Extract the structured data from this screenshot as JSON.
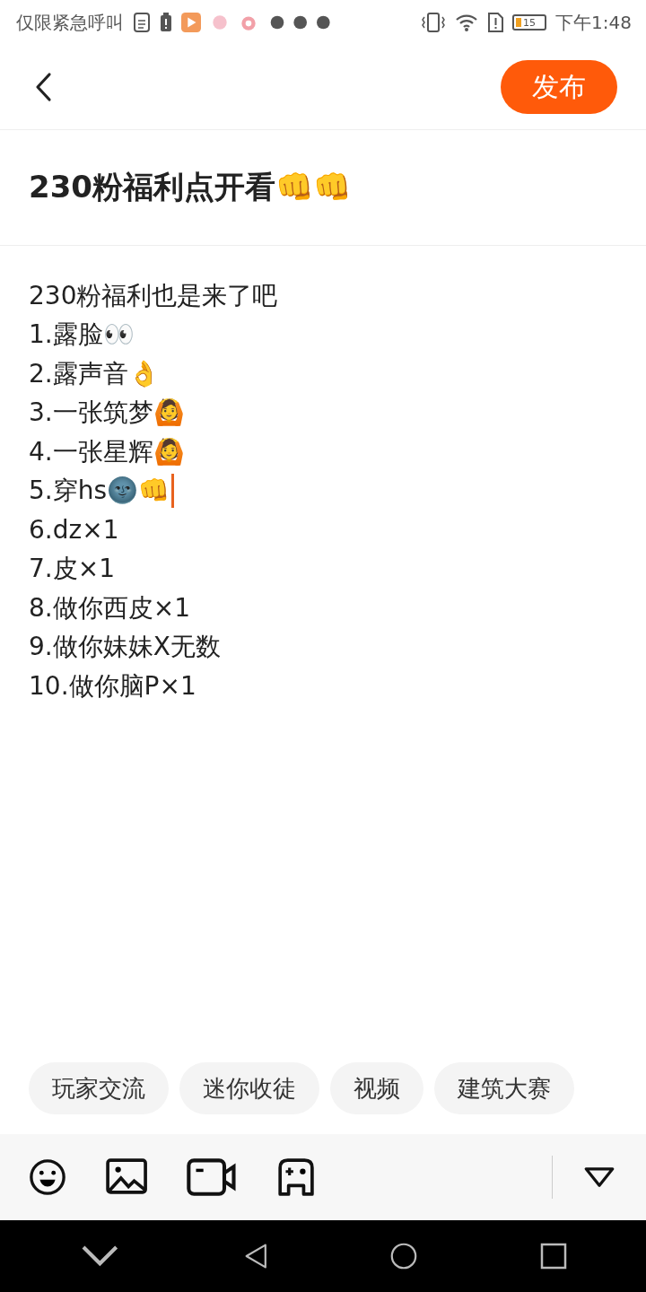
{
  "status_bar": {
    "notice": "仅限紧急呼叫",
    "battery": "15",
    "time": "下午1:48"
  },
  "header": {
    "publish_button": "发布"
  },
  "post": {
    "title": "230粉福利点开看👊👊",
    "lines": [
      {
        "text": "230粉福利也是来了吧",
        "cursor": false
      },
      {
        "text": "1.露脸👀",
        "cursor": false
      },
      {
        "text": "2.露声音👌",
        "cursor": false
      },
      {
        "text": "3.一张筑梦🙆",
        "cursor": false
      },
      {
        "text": "4.一张星辉🙆",
        "cursor": false
      },
      {
        "text": "5.穿hs🌚👊",
        "cursor": true
      },
      {
        "text": "6.dz×1",
        "cursor": false
      },
      {
        "text": "7.皮×1",
        "cursor": false
      },
      {
        "text": "8.做你西皮×1",
        "cursor": false
      },
      {
        "text": "9.做你妹妹X无数",
        "cursor": false
      },
      {
        "text": "10.做你脑P×1",
        "cursor": false
      }
    ]
  },
  "tags": [
    "玩家交流",
    "迷你收徒",
    "视频",
    "建筑大赛"
  ]
}
